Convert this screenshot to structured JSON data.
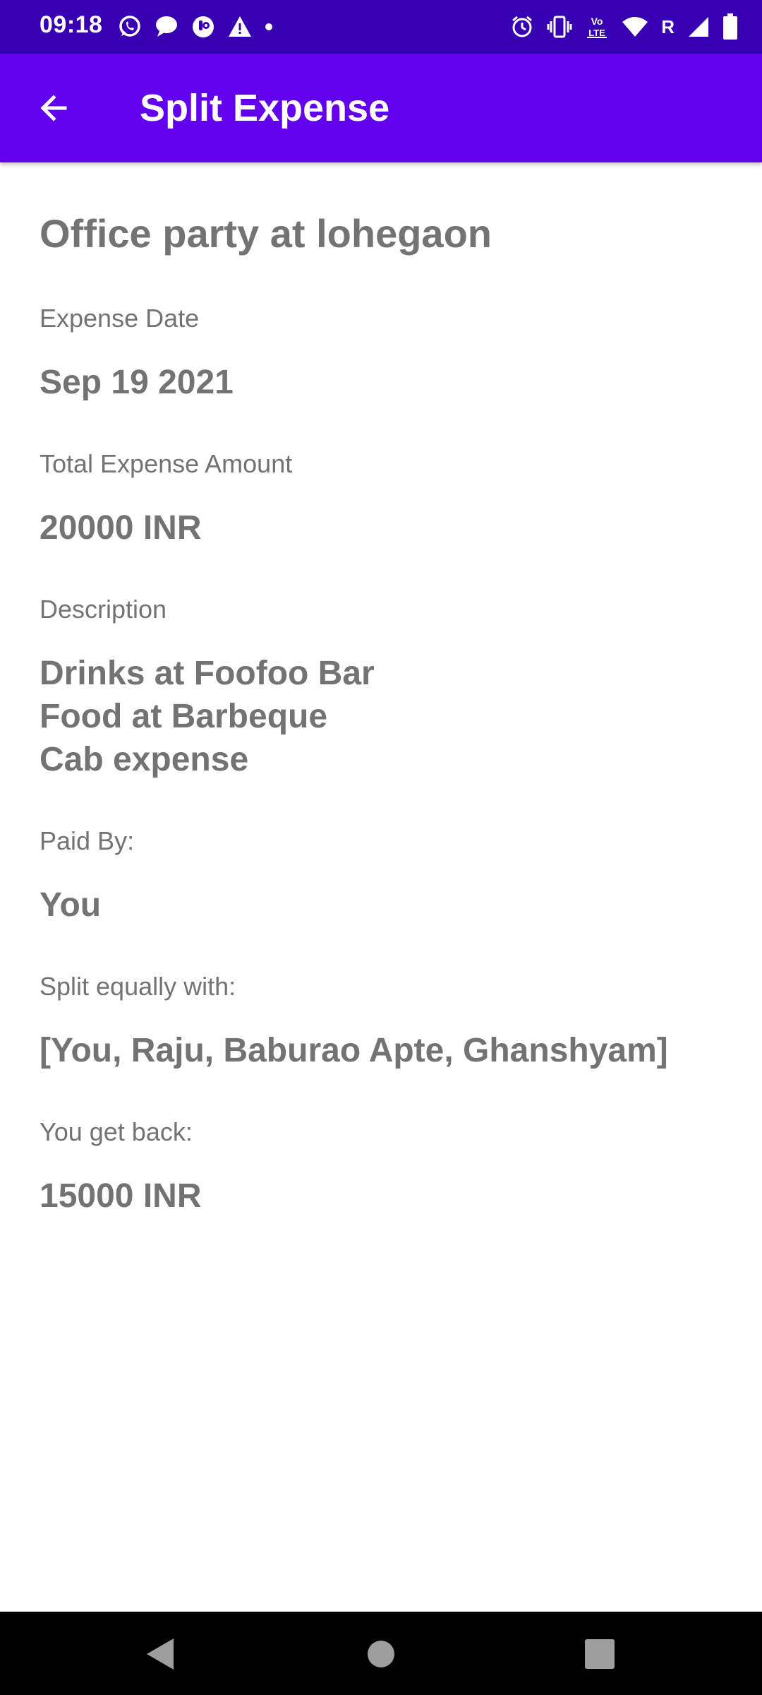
{
  "status_bar": {
    "time": "09:18",
    "network_letter": "R",
    "volte_label": "Vo LTE",
    "left_icons": [
      "whatsapp-icon",
      "message-icon",
      "app-notification-icon",
      "warning-icon",
      "dot-icon"
    ],
    "right_icons": [
      "alarm-icon",
      "vibrate-icon",
      "volte-icon",
      "wifi-icon",
      "roaming-indicator",
      "signal-icon",
      "battery-icon"
    ]
  },
  "app_bar": {
    "title": "Split Expense",
    "back_icon": "arrow-back-icon"
  },
  "expense": {
    "title": "Office party at lohegaon",
    "date_label": "Expense Date",
    "date_value": "Sep 19 2021",
    "amount_label": "Total Expense Amount",
    "amount_value": "20000 INR",
    "description_label": "Description",
    "description_value": "Drinks at Foofoo Bar\nFood at Barbeque\nCab expense",
    "paid_by_label": "Paid By:",
    "paid_by_value": "You",
    "split_label": "Split equally with:",
    "split_value": "[You, Raju, Baburao Apte, Ghanshyam]",
    "get_back_label": "You get back:",
    "get_back_value": "15000 INR"
  },
  "colors": {
    "status_bar": "#3700b3",
    "app_bar": "#6200ee",
    "text": "#737373",
    "nav_bar": "#000000"
  },
  "nav_bar": {
    "buttons": [
      "back-triangle-icon",
      "home-circle-icon",
      "recents-square-icon"
    ]
  }
}
